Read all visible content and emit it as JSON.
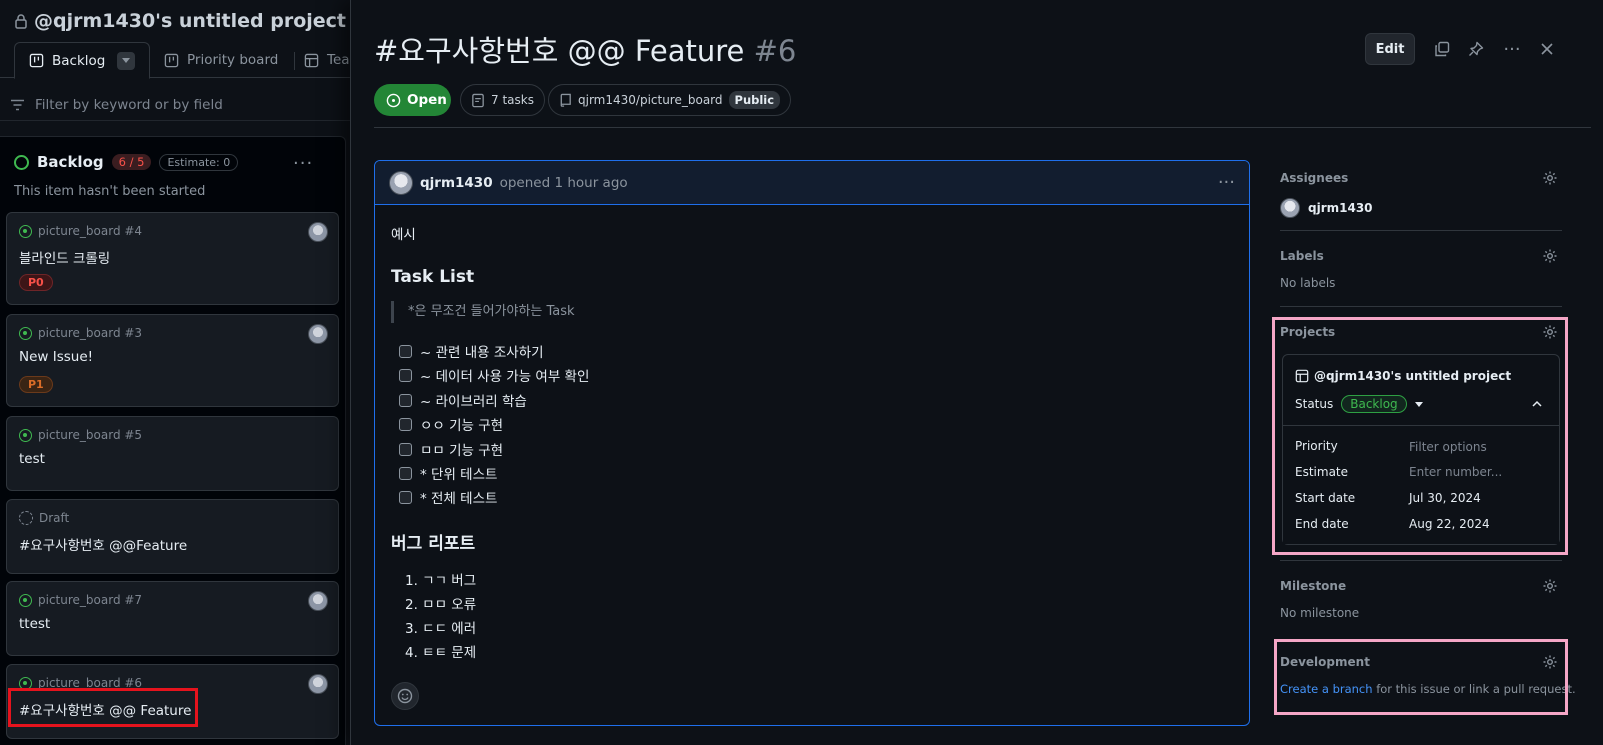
{
  "board": {
    "project_title": "@qjrm1430's untitled project",
    "tabs": [
      {
        "label": "Backlog"
      },
      {
        "label": "Priority board"
      },
      {
        "label": "Tea"
      }
    ],
    "filter_placeholder": "Filter by keyword or by field",
    "column": {
      "name": "Backlog",
      "count": "6 / 5",
      "estimate": "Estimate: 0",
      "description": "This item hasn't been started"
    },
    "cards": [
      {
        "meta": "picture_board #4",
        "title": "블라인드 크롤링",
        "label": "P0"
      },
      {
        "meta": "picture_board #3",
        "title": "New Issue!",
        "label": "P1"
      },
      {
        "meta": "picture_board #5",
        "title": "test"
      },
      {
        "meta": "Draft",
        "title": "#요구사항번호 @@Feature"
      },
      {
        "meta": "picture_board #7",
        "title": "ttest"
      },
      {
        "meta": "picture_board #6",
        "title": "#요구사항번호 @@ Feature"
      }
    ]
  },
  "issue": {
    "title": "#요구사항번호 @@ Feature",
    "number": "#6",
    "edit_label": "Edit",
    "state": "Open",
    "tasks": "7 tasks",
    "repo": "qjrm1430/picture_board",
    "visibility": "Public",
    "comment": {
      "author": "qjrm1430",
      "time": "opened 1 hour ago",
      "intro": "예시",
      "task_heading": "Task List",
      "quote": "*은 무조건 들어가야하는 Task",
      "tasks": [
        "~ 관련 내용 조사하기",
        "~ 데이터 사용 가능 여부 확인",
        "~ 라이브러리 학습",
        "ㅇㅇ 기능 구현",
        "ㅁㅁ 기능 구현",
        "* 단위 테스트",
        "* 전체 테스트"
      ],
      "bug_heading": "버그 리포트",
      "bugs": [
        "1. ㄱㄱ 버그",
        "2. ㅁㅁ 오류",
        "3. ㄷㄷ 에러",
        "4. ㅌㅌ 문제"
      ]
    }
  },
  "sidebar": {
    "assignees": {
      "title": "Assignees",
      "user": "qjrm1430"
    },
    "labels": {
      "title": "Labels",
      "value": "No labels"
    },
    "projects": {
      "title": "Projects",
      "name": "@qjrm1430's untitled project",
      "status_label": "Status",
      "status_value": "Backlog",
      "fields": [
        {
          "label": "Priority",
          "value": "Filter options"
        },
        {
          "label": "Estimate",
          "value": "Enter number..."
        },
        {
          "label": "Start date",
          "value": "Jul 30, 2024"
        },
        {
          "label": "End date",
          "value": "Aug 22, 2024"
        }
      ]
    },
    "milestone": {
      "title": "Milestone",
      "value": "No milestone"
    },
    "development": {
      "title": "Development",
      "link": "Create a branch",
      "rest": " for this issue or link a pull request."
    }
  },
  "colors": {
    "background": "#0d1117",
    "open_green": "#238636",
    "accent_blue": "#1f6feb",
    "highlight_red": "#e5131d",
    "highlight_pink": "#f4a6c6"
  }
}
